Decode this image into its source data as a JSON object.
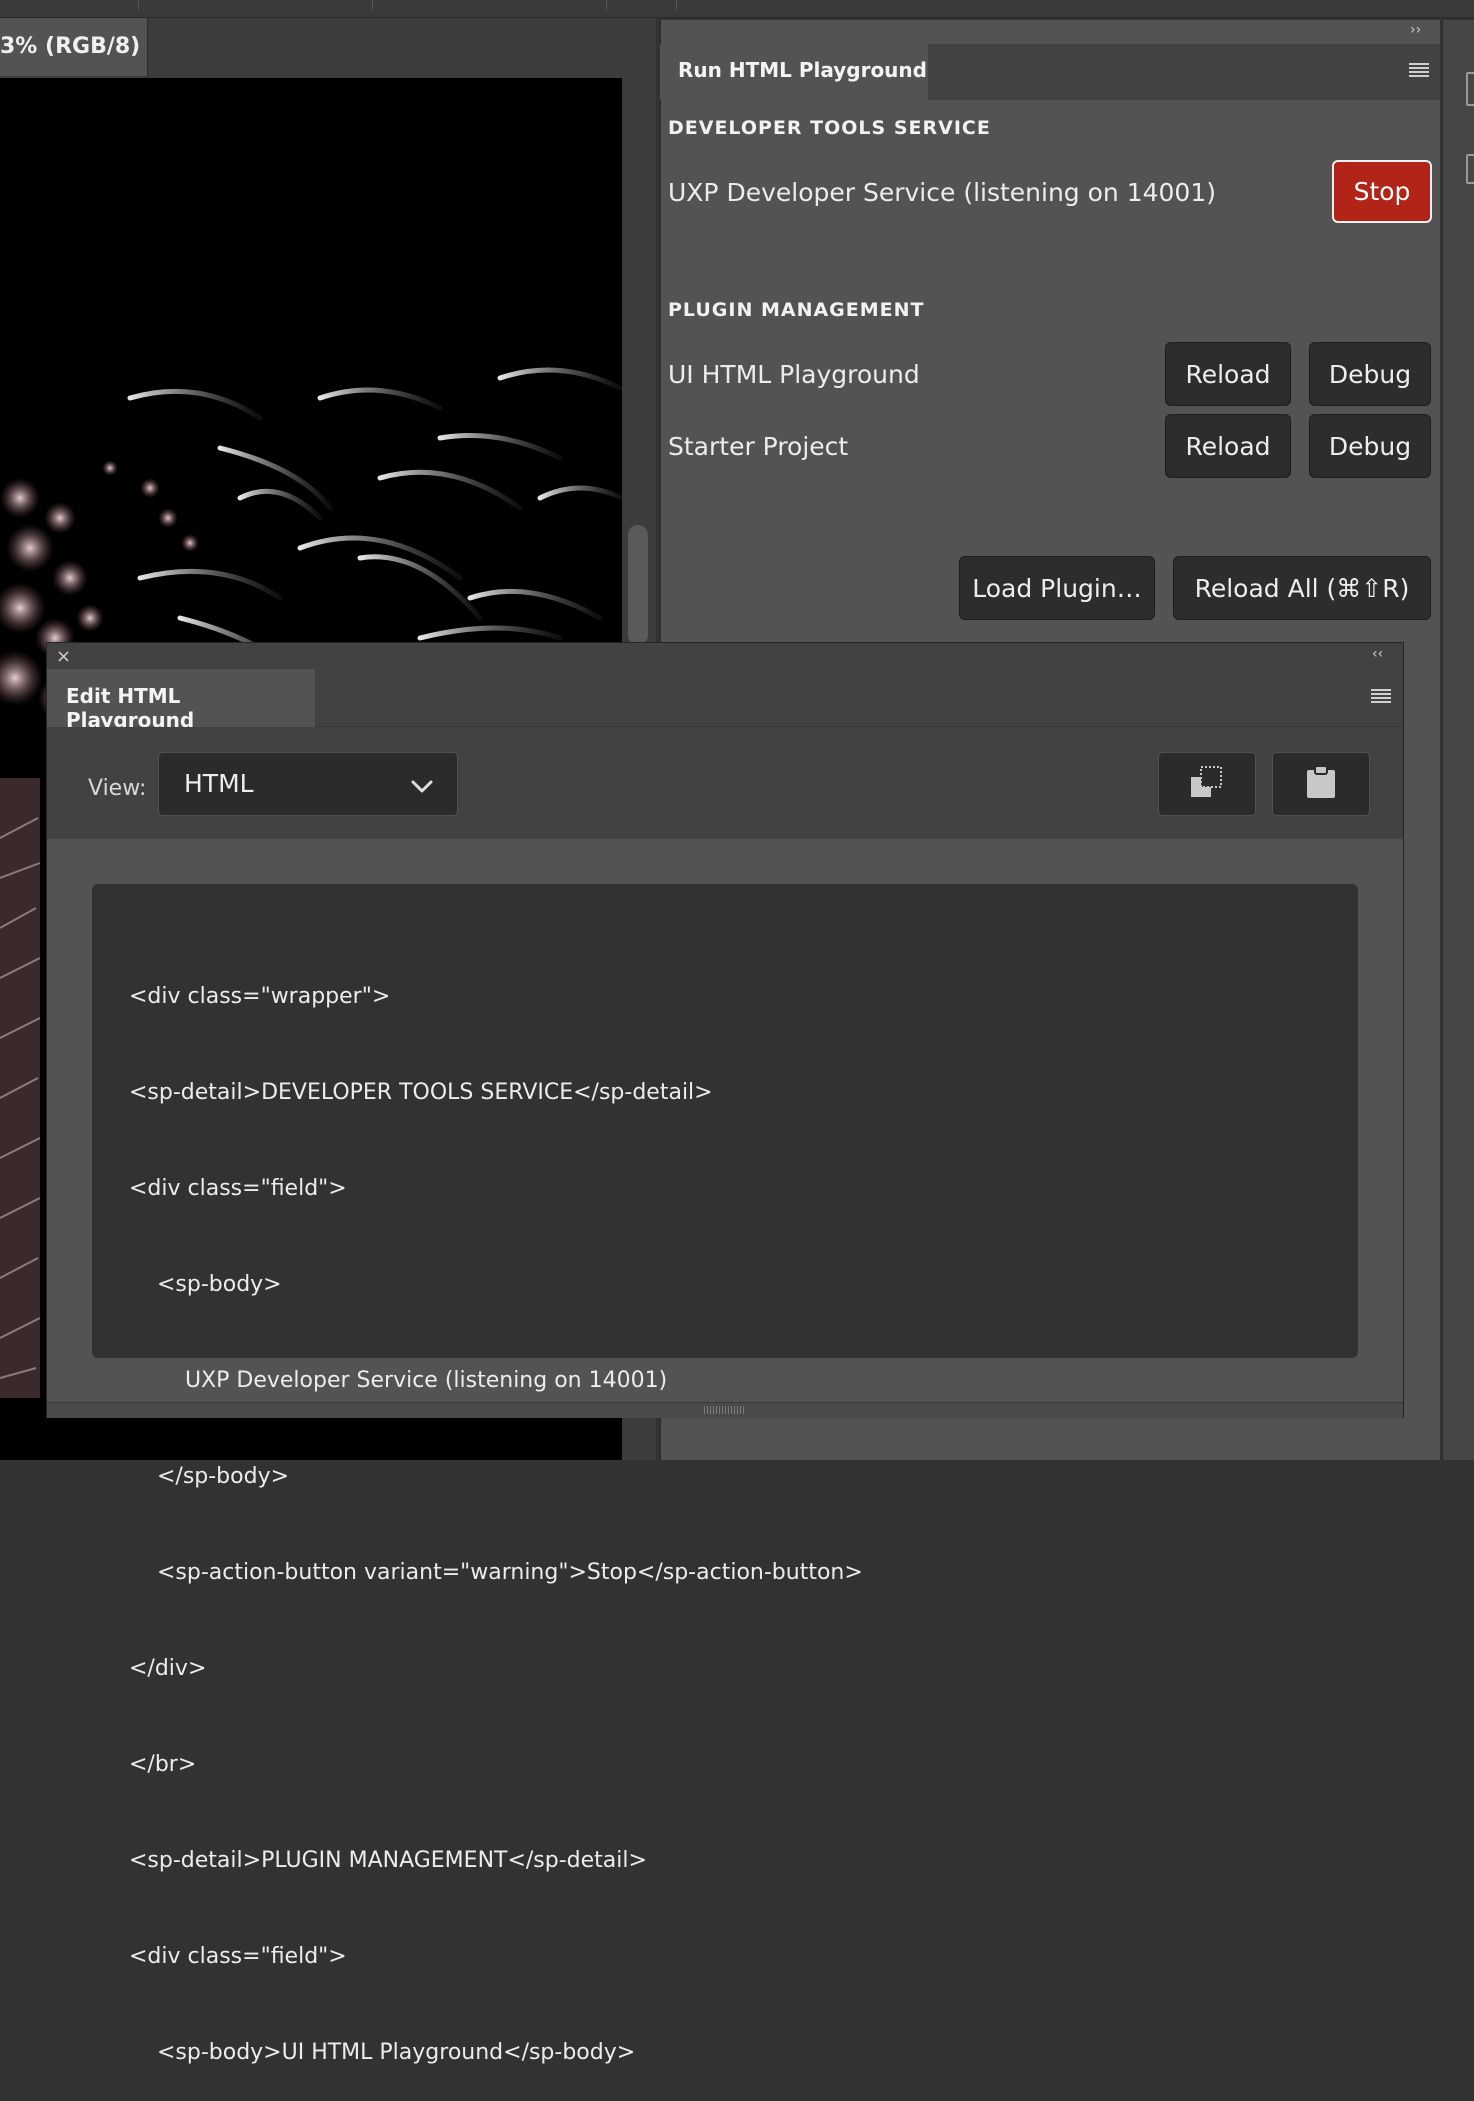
{
  "document": {
    "tab_title": "3% (RGB/8)"
  },
  "run_panel": {
    "tab_label": "Run HTML Playground",
    "developer_section": {
      "heading": "DEVELOPER TOOLS SERVICE",
      "service_status": "UXP Developer Service (listening on 14001)",
      "stop_label": "Stop"
    },
    "plugin_section": {
      "heading": "PLUGIN MANAGEMENT",
      "plugins": [
        {
          "name": "UI HTML Playground",
          "reload_label": "Reload",
          "debug_label": "Debug"
        },
        {
          "name": "Starter Project",
          "reload_label": "Reload",
          "debug_label": "Debug"
        }
      ],
      "load_plugin_label": "Load Plugin…",
      "reload_all_label": "Reload All (⌘⇧R)"
    }
  },
  "edit_panel": {
    "tab_label": "Edit HTML Playground",
    "close_glyph": "×",
    "collapse_glyph": "‹‹",
    "view_label": "View:",
    "view_value": "HTML",
    "code_lines": [
      "<div class=\"wrapper\">",
      "<sp-detail>DEVELOPER TOOLS SERVICE</sp-detail>",
      "<div class=\"field\">",
      "    <sp-body>",
      "        UXP Developer Service (listening on 14001)",
      "    </sp-body>",
      "    <sp-action-button variant=\"warning\">Stop</sp-action-button>",
      "</div>",
      "</br>",
      "<sp-detail>PLUGIN MANAGEMENT</sp-detail>",
      "<div class=\"field\">",
      "    <sp-body>UI HTML Playground</sp-body>"
    ]
  },
  "chrome": {
    "expand_glyph": "››"
  },
  "icons": {
    "panel_menu": "hamburger-icon",
    "view_dropdown": "chevron-down-icon",
    "copy": "copy-icon",
    "paste": "clipboard-icon",
    "close": "close-icon",
    "collapse": "double-chevron-left-icon",
    "expand": "double-chevron-right-icon"
  },
  "colors": {
    "stop_button": "#b32418",
    "panel_bg": "#535353",
    "code_bg": "#323232"
  }
}
